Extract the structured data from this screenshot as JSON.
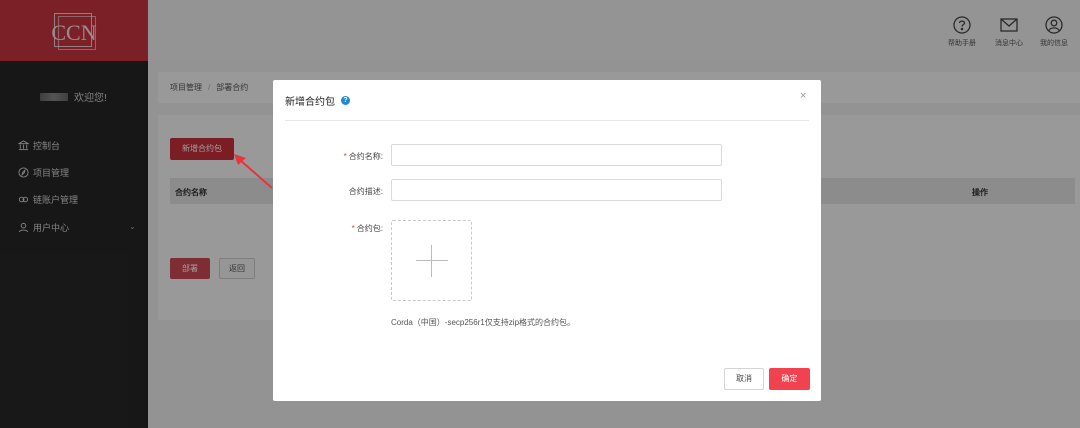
{
  "logo": {
    "text": "CCN"
  },
  "sidebar": {
    "welcome": "欢迎您!",
    "items": [
      {
        "label": "控制台",
        "icon": "bank-icon"
      },
      {
        "label": "项目管理",
        "icon": "compass-icon"
      },
      {
        "label": "链账户管理",
        "icon": "chain-icon"
      },
      {
        "label": "用户中心",
        "icon": "user-icon"
      }
    ]
  },
  "header": {
    "help": "帮助手册",
    "messages": "消息中心",
    "profile": "我的信息"
  },
  "breadcrumb": {
    "parent": "项目管理",
    "current": "部署合约"
  },
  "main": {
    "add_button": "新增合约包",
    "columns": {
      "name": "合约名称",
      "action": "操作"
    },
    "deploy_button": "部署",
    "back_button": "返回"
  },
  "modal": {
    "title": "新增合约包",
    "close": "×",
    "fields": {
      "name_label": "合约名称:",
      "desc_label": "合约描述:",
      "package_label": "合约包:"
    },
    "required_mark": "*",
    "hint": "Corda（中国）-secp256r1仅支持zip格式的合约包。",
    "cancel": "取消",
    "ok": "确定"
  },
  "colors": {
    "brand": "#c7353f",
    "primary_button": "#f1434f",
    "sidebar_bg": "#262626",
    "help_icon": "#1f8ad8",
    "arrow": "#e5363f"
  }
}
